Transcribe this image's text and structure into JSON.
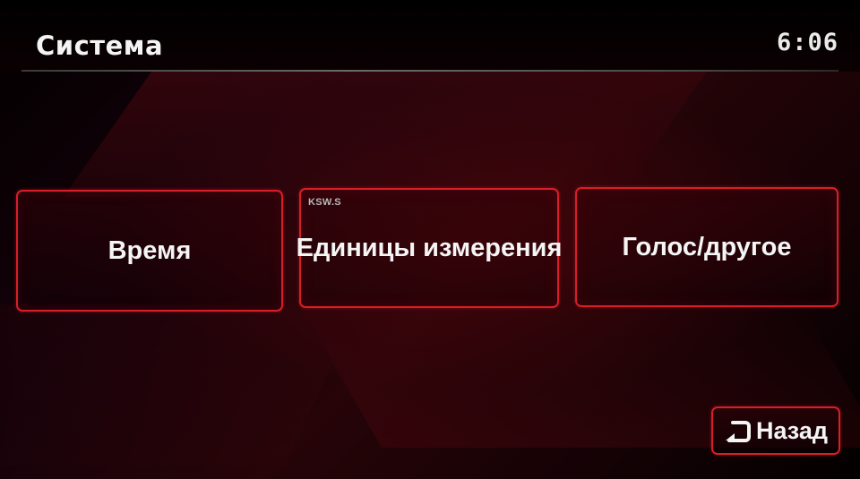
{
  "header": {
    "title": "Система",
    "clock": "6:06"
  },
  "menu": {
    "items": [
      {
        "label": "Время"
      },
      {
        "label": "Единицы измерения"
      },
      {
        "label": "Голос/другое"
      }
    ]
  },
  "watermark": "KSW.S",
  "back_button": {
    "label": "Назад",
    "icon": "return-arrow-icon"
  },
  "colors": {
    "accent": "#d81e28",
    "text": "#f5f5f5",
    "background": "#14020a"
  }
}
